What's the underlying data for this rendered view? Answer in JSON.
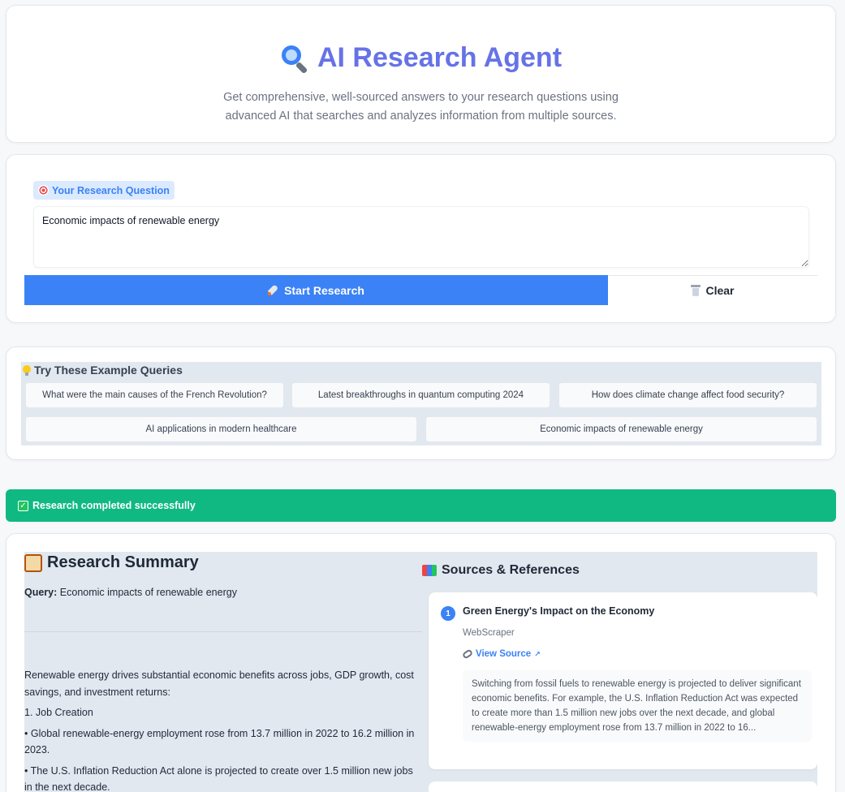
{
  "header": {
    "title": "AI Research Agent",
    "subtitle": "Get comprehensive, well-sourced answers to your research questions using advanced AI that searches and analyzes information from multiple sources."
  },
  "question": {
    "label": "Your Research Question",
    "value": "Economic impacts of renewable energy",
    "start_button": "Start Research",
    "clear_button": "Clear"
  },
  "examples": {
    "title": "Try These Example Queries",
    "items": [
      "What were the main causes of the French Revolution?",
      "Latest breakthroughs in quantum computing 2024",
      "How does climate change affect food security?",
      "AI applications in modern healthcare",
      "Economic impacts of renewable energy"
    ]
  },
  "status": {
    "text": "Research completed successfully",
    "color": "#10b981"
  },
  "summary": {
    "title": "Research Summary",
    "query_label": "Query:",
    "query_value": "Economic impacts of renewable energy",
    "intro": "Renewable energy drives substantial economic benefits across jobs, GDP growth, cost savings, and investment returns:",
    "heading1": "1. Job Creation",
    "bullet1": "• Global renewable-energy employment rose from 13.7 million in 2022 to 16.2 million in 2023.",
    "bullet2": "• The U.S. Inflation Reduction Act alone is projected to create over 1.5 million new jobs in the next decade."
  },
  "sources": {
    "title": "Sources & References",
    "items": [
      {
        "number": "1",
        "name": "Green Energy's Impact on the Economy",
        "tool": "WebScraper",
        "link_label": "View Source",
        "excerpt": "Switching from fossil fuels to renewable energy is projected to deliver significant economic benefits. For example, the U.S. Inflation Reduction Act was expected to create more than 1.5 million new jobs over the next decade, and global renewable-energy employment rose from 13.7 million in 2022 to 16..."
      }
    ]
  },
  "colors": {
    "accent": "#3b82f6",
    "title": "#6673e6",
    "success": "#10b981"
  },
  "icons": {
    "title_icon": "magnifying-glass-icon",
    "label_icon": "target-icon",
    "start_icon": "rocket-icon",
    "clear_icon": "trash-icon",
    "examples_icon": "lightbulb-icon",
    "status_icon": "check-icon",
    "summary_icon": "scroll-icon",
    "sources_icon": "books-icon",
    "link_icon": "link-icon"
  }
}
